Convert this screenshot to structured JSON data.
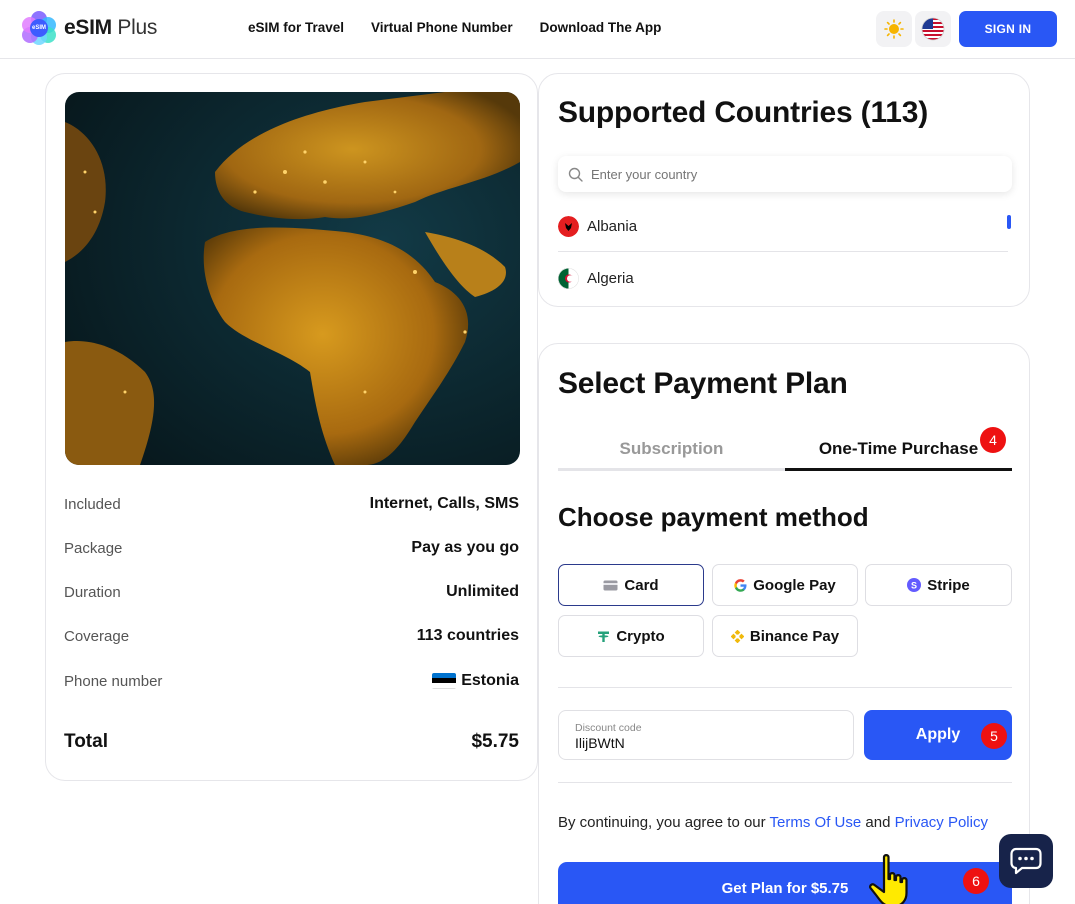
{
  "header": {
    "logo_brand": "eSIM",
    "logo_suffix": "Plus",
    "logo_badge": "eSIM",
    "nav": [
      "eSIM for Travel",
      "Virtual Phone Number",
      "Download The App"
    ],
    "theme_icon": "sun-icon",
    "language_icon": "us-flag-icon",
    "sign_in_label": "SIGN IN"
  },
  "plan_details": {
    "rows": [
      {
        "label": "Included",
        "value": "Internet, Calls, SMS"
      },
      {
        "label": "Package",
        "value": "Pay as you go"
      },
      {
        "label": "Duration",
        "value": "Unlimited"
      },
      {
        "label": "Coverage",
        "value": "113 countries"
      },
      {
        "label": "Phone number",
        "value": "Estonia"
      }
    ],
    "total_label": "Total",
    "total_value": "$5.75"
  },
  "countries": {
    "title": "Supported Countries (113)",
    "search_placeholder": "Enter your country",
    "items": [
      {
        "name": "Albania"
      },
      {
        "name": "Algeria"
      }
    ]
  },
  "payment": {
    "title": "Select Payment Plan",
    "tabs": [
      {
        "label": "Subscription",
        "active": false
      },
      {
        "label": "One-Time Purchase",
        "active": true
      }
    ],
    "method_title": "Choose payment method",
    "methods": [
      {
        "label": "Card",
        "icon": "card-icon",
        "selected": true
      },
      {
        "label": "Google Pay",
        "icon": "google-icon",
        "selected": false
      },
      {
        "label": "Stripe",
        "icon": "stripe-icon",
        "selected": false
      },
      {
        "label": "Crypto",
        "icon": "tether-icon",
        "selected": false
      },
      {
        "label": "Binance Pay",
        "icon": "binance-icon",
        "selected": false
      }
    ],
    "discount_label": "Discount code",
    "discount_value": "IlijBWtN",
    "apply_label": "Apply",
    "terms_prefix": "By continuing, you agree to our",
    "terms_link": "Terms Of Use",
    "terms_and": "and",
    "privacy_link": "Privacy Policy",
    "cta_label": "Get Plan for $5.75"
  },
  "annotations": {
    "step_tab": "4",
    "step_apply": "5",
    "step_cta": "6"
  },
  "colors": {
    "accent": "#2957f5",
    "badge": "#ee1111",
    "chat_bg": "#17234a"
  }
}
